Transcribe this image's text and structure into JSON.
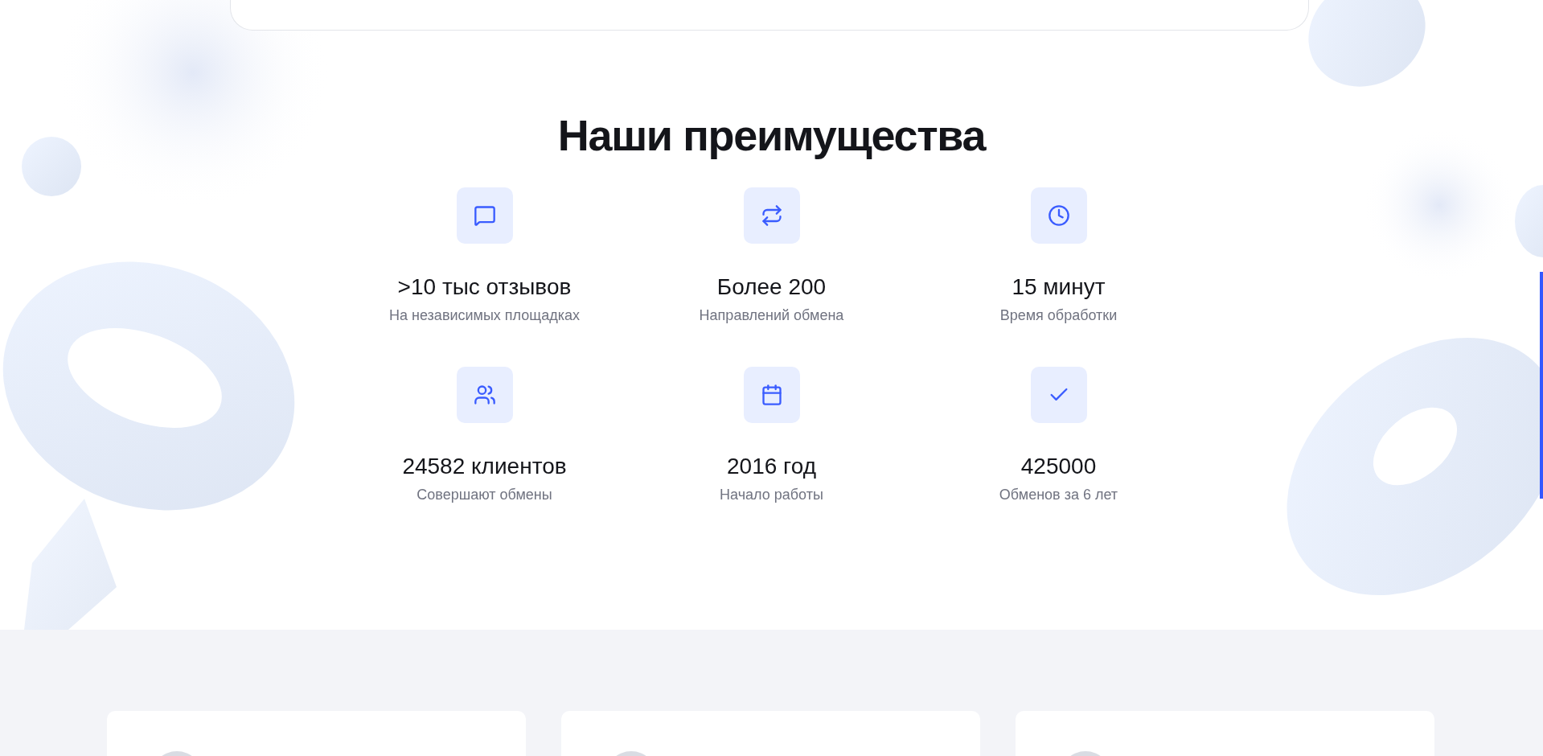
{
  "section_title": "Наши преимущества",
  "advantages": [
    {
      "kind": "chat",
      "value": ">10 тыс отзывов",
      "caption": "На независимых площадках"
    },
    {
      "kind": "exchange",
      "value": "Более 200",
      "caption": "Направлений обмена"
    },
    {
      "kind": "clock",
      "value": "15 минут",
      "caption": "Время обработки"
    },
    {
      "kind": "users",
      "value": "24582 клиентов",
      "caption": "Совершают обмены"
    },
    {
      "kind": "calendar",
      "value": "2016 год",
      "caption": "Начало работы"
    },
    {
      "kind": "check",
      "value": "425000",
      "caption": "Обменов за 6 лет"
    }
  ]
}
